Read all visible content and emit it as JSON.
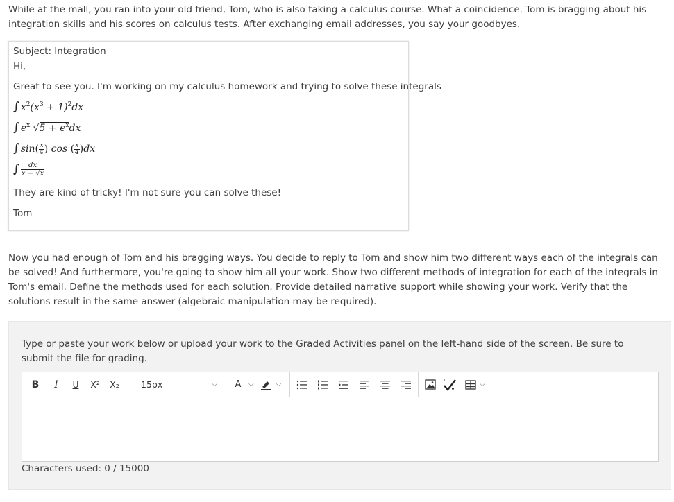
{
  "intro_text": "While at the mall, you ran into your old friend, Tom, who is also taking a calculus course. What a coincidence. Tom is bragging about his integration skills and his scores on calculus tests. After exchanging email addresses, you say your goodbyes.",
  "email": {
    "subject": "Subject: Integration",
    "greeting": "Hi,",
    "intro": "Great to see you. I'm working on my calculus homework and trying to solve these integrals",
    "closing_line": "They are kind of tricky! I'm not sure you can solve these!",
    "signature": "Tom",
    "integrals": {
      "i1": {
        "a": "x",
        "a_exp": "2",
        "b": "(x",
        "b_exp": "3",
        "c": " + 1)",
        "c_exp": "2",
        "d": "dx"
      },
      "i2": {
        "a": "e",
        "a_exp": "x",
        "b": "5 + e",
        "b_exp": "x",
        "d": "dx"
      },
      "i3": {
        "sin": "sin",
        "cos": "cos",
        "num": "x",
        "den": "4",
        "d": "dx"
      },
      "i4": {
        "num": "dx",
        "den": "x − √x"
      }
    }
  },
  "task_text": "Now you had enough of Tom and his bragging ways. You decide to reply to Tom and show him two different ways each of the integrals can be solved! And furthermore, you're going to show him all your work. Show two different methods of integration for each of the integrals in Tom's email. Define the methods used for each solution. Provide detailed narrative support while showing your work. Verify that the solutions result in the same answer (algebraic manipulation may be required).",
  "answer_panel": {
    "instruction": "Type or paste your work below or upload your work to the Graded Activities panel on the left-hand side of the screen. Be sure to submit the file for grading.",
    "font_size": "15px",
    "char_counter": "Characters used: 0 / 15000",
    "toolbar": {
      "bold": "B",
      "italic": "I",
      "underline": "U",
      "superscript": "X²",
      "subscript": "X₂",
      "font_color": "A"
    },
    "icons": [
      "bold-icon",
      "italic-icon",
      "underline-icon",
      "superscript-icon",
      "subscript-icon",
      "font-color-icon",
      "highlight-icon",
      "bulleted-list-icon",
      "numbered-list-icon",
      "indent-icon",
      "align-left-icon",
      "align-center-icon",
      "align-right-icon",
      "image-icon",
      "spellcheck-icon",
      "table-icon"
    ]
  }
}
